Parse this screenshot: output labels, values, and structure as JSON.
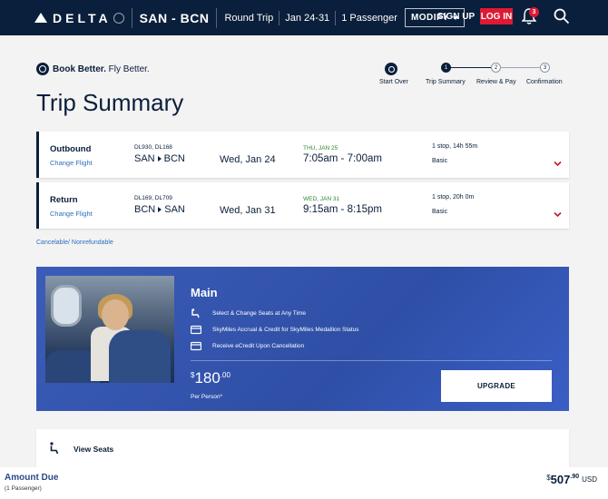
{
  "header": {
    "brand": "DELTA",
    "route": "SAN - BCN",
    "trip_type": "Round Trip",
    "dates": "Jan 24-31",
    "passengers": "1 Passenger",
    "modify_label": "MODIFY",
    "signup_label": "SIGN UP",
    "login_label": "LOG IN",
    "notification_count": "3"
  },
  "book_better": {
    "bold": "Book Better.",
    "rest": " Fly Better."
  },
  "page_title": "Trip Summary",
  "stepper": [
    {
      "label": "Start Over",
      "num": ""
    },
    {
      "label": "Trip Summary",
      "num": "1"
    },
    {
      "label": "Review & Pay",
      "num": "2"
    },
    {
      "label": "Confirmation",
      "num": "3"
    }
  ],
  "flights": [
    {
      "type": "Outbound",
      "change": "Change Flight",
      "flight_numbers": "DL930, DL168",
      "from": "SAN",
      "to": "BCN",
      "date": "Wed, Jan 24",
      "arrival_date": "THU, JAN 25",
      "times": "7:05am - 7:00am",
      "stops": "1 stop, 14h 55m",
      "fare": "Basic"
    },
    {
      "type": "Return",
      "change": "Change Flight",
      "flight_numbers": "DL169, DL709",
      "from": "BCN",
      "to": "SAN",
      "date": "Wed, Jan 31",
      "arrival_date": "WED, JAN 31",
      "times": "9:15am - 8:15pm",
      "stops": "1 stop, 20h 0m",
      "fare": "Basic"
    }
  ],
  "cancel_note": "Cancelable/ Nonrefundable",
  "upsell": {
    "title": "Main",
    "features": [
      "Select & Change Seats at Any Time",
      "SkyMiles Accrual & Credit for SkyMiles Medallion Status",
      "Receive eCredit Upon Cancellation"
    ],
    "currency": "$",
    "price": "180",
    "cents": ".00",
    "per": "Per Person*",
    "button": "UPGRADE"
  },
  "view_seats": "View Seats",
  "footer": {
    "amount_due": "Amount Due",
    "passengers": "(1 Passenger)",
    "currency": "$",
    "total": "507",
    "cents": ".90",
    "ccy": "USD"
  },
  "colors": {
    "navy": "#0a1f3b",
    "red": "#e01933",
    "blue": "#3b5cb8",
    "green": "#2c8a2c"
  }
}
